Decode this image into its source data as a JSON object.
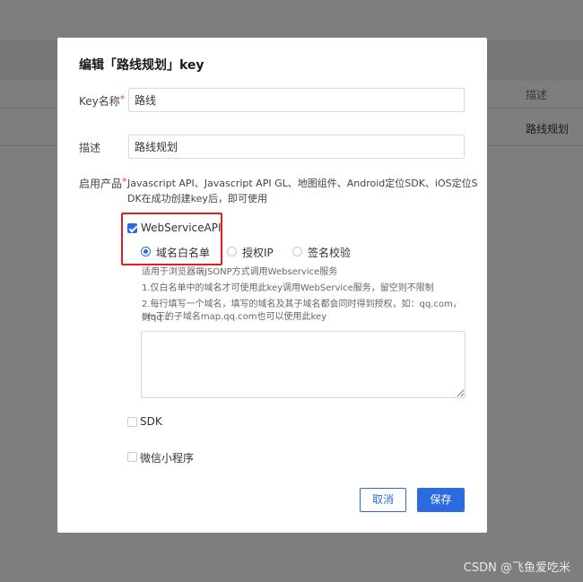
{
  "background": {
    "column_header": "描述",
    "column_value": "路线规划"
  },
  "modal": {
    "title": "编辑「路线规划」key",
    "fields": {
      "key_name_label": "Key名称",
      "key_name_value": "路线",
      "description_label": "描述",
      "description_value": "路线规划",
      "products_label": "启用产品",
      "required_mark": "*"
    },
    "products_description_line1": "Javascript API、Javascript API GL、地图组件、Android定位SDK、iOS定位S",
    "products_description_line2": "DK在成功创建key后，即可使用",
    "webservice": {
      "label": "WebServiceAPI",
      "checked": true,
      "radios": [
        {
          "label": "域名白名单",
          "checked": true
        },
        {
          "label": "授权IP",
          "checked": false
        },
        {
          "label": "签名校验",
          "checked": false
        }
      ],
      "hints": [
        "适用于浏览器端JSONP方式调用Webservice服务",
        "1.仅白名单中的域名才可使用此key调用WebService服务，留空则不限制",
        "2.每行填写一个域名，填写的域名及其子域名都会同时得到授权，如：qq.com，则qq.c",
        "om下的子域名map.qq.com也可以使用此key"
      ],
      "domain_textarea_value": ""
    },
    "sdk": {
      "label": "SDK",
      "checked": false
    },
    "miniprogram": {
      "label": "微信小程序",
      "checked": false
    },
    "buttons": {
      "cancel": "取消",
      "save": "保存"
    }
  },
  "watermark": "CSDN @飞鱼爱吃米",
  "colors": {
    "primary": "#2c6bdf",
    "highlight_border": "#e02020",
    "required": "#e54545"
  }
}
